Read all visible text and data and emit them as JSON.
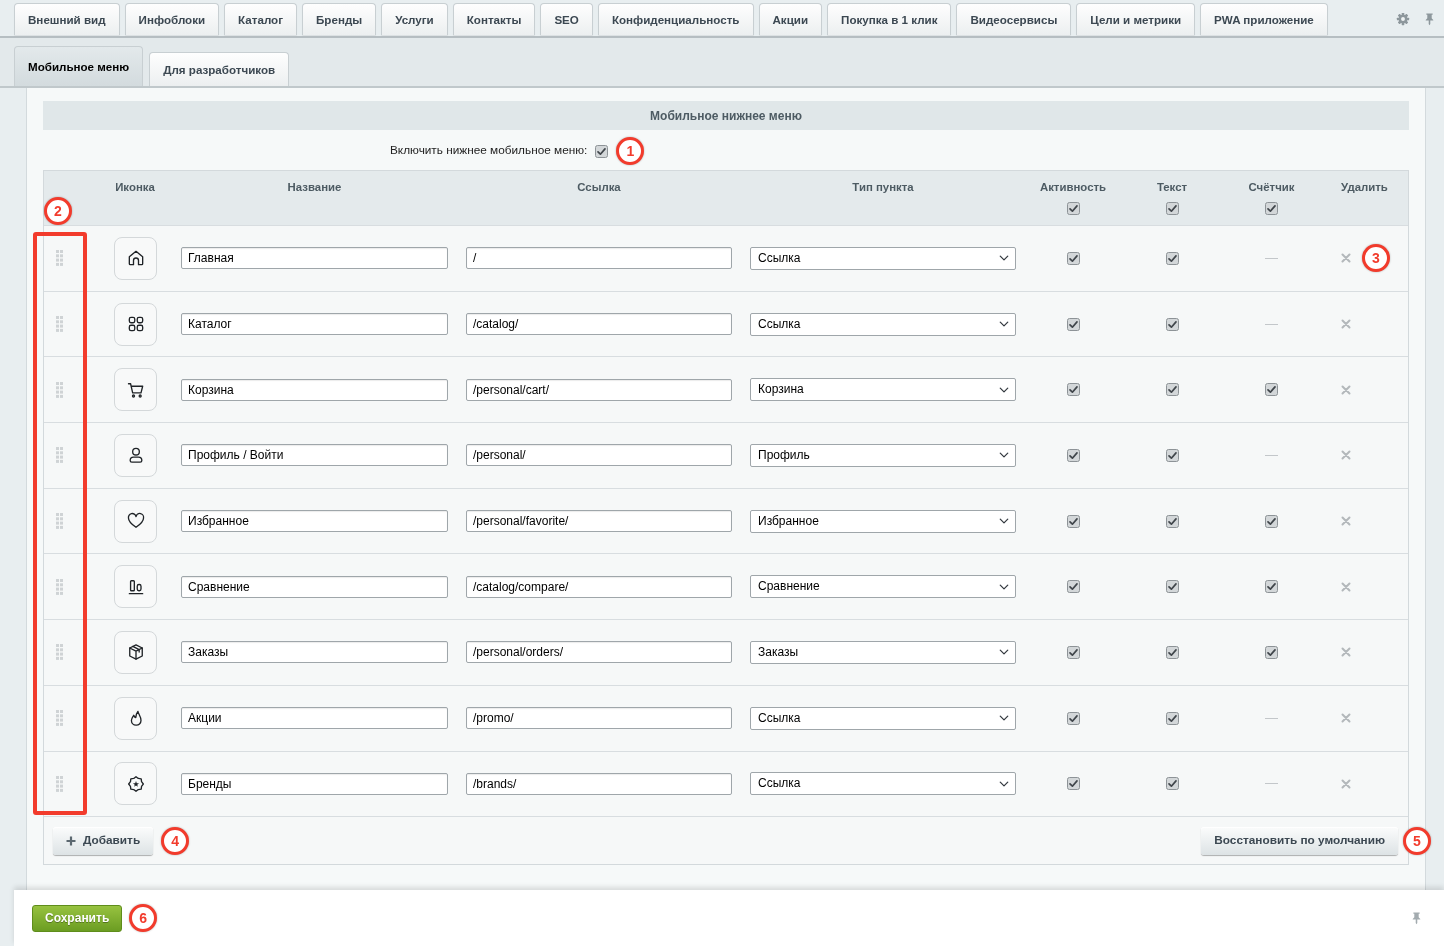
{
  "top_tabs": [
    {
      "label": "Внешний вид",
      "selected": false
    },
    {
      "label": "Инфоблоки",
      "selected": false
    },
    {
      "label": "Каталог",
      "selected": false
    },
    {
      "label": "Бренды",
      "selected": false
    },
    {
      "label": "Услуги",
      "selected": false
    },
    {
      "label": "Контакты",
      "selected": false
    },
    {
      "label": "SEO",
      "selected": false
    },
    {
      "label": "Конфиденциальность",
      "selected": false
    },
    {
      "label": "Акции",
      "selected": false
    },
    {
      "label": "Покупка в 1 клик",
      "selected": false
    },
    {
      "label": "Видеосервисы",
      "selected": false
    },
    {
      "label": "Цели и метрики",
      "selected": false
    },
    {
      "label": "PWA приложение",
      "selected": false
    }
  ],
  "sub_tabs": [
    {
      "label": "Мобильное меню",
      "selected": true
    },
    {
      "label": "Для разработчиков",
      "selected": false
    }
  ],
  "section": {
    "title": "Мобильное нижнее меню",
    "enable_label": "Включить нижнее мобильное меню:",
    "enabled": true,
    "annotation": "1"
  },
  "table": {
    "annotation": "2",
    "highlight_drag_column": true,
    "columns": [
      {
        "label": "Иконка",
        "kind": "plain"
      },
      {
        "label": "Название",
        "kind": "plain"
      },
      {
        "label": "Ссылка",
        "kind": "plain"
      },
      {
        "label": "Тип пункта",
        "kind": "plain"
      },
      {
        "label": "Активность",
        "kind": "toggle",
        "checked": true
      },
      {
        "label": "Текст",
        "kind": "toggle",
        "checked": true
      },
      {
        "label": "Счётчик",
        "kind": "toggle",
        "checked": true
      },
      {
        "label": "Удалить",
        "kind": "plain"
      }
    ],
    "rows": [
      {
        "name": "Главная",
        "link": "/",
        "type": "Ссылка",
        "active": true,
        "text": true,
        "counter": {
          "kind": "dash"
        },
        "annotation": "3"
      },
      {
        "name": "Каталог",
        "link": "/catalog/",
        "type": "Ссылка",
        "active": true,
        "text": true,
        "counter": {
          "kind": "dash"
        }
      },
      {
        "name": "Корзина",
        "link": "/personal/cart/",
        "type": "Корзина",
        "active": true,
        "text": true,
        "counter": {
          "kind": "checkbox",
          "checked": true
        }
      },
      {
        "name": "Профиль / Войти",
        "link": "/personal/",
        "type": "Профиль",
        "active": true,
        "text": true,
        "counter": {
          "kind": "dash"
        }
      },
      {
        "name": "Избранное",
        "link": "/personal/favorite/",
        "type": "Избранное",
        "active": true,
        "text": true,
        "counter": {
          "kind": "checkbox",
          "checked": true
        }
      },
      {
        "name": "Сравнение",
        "link": "/catalog/compare/",
        "type": "Сравнение",
        "active": true,
        "text": true,
        "counter": {
          "kind": "checkbox",
          "checked": true
        }
      },
      {
        "name": "Заказы",
        "link": "/personal/orders/",
        "type": "Заказы",
        "active": true,
        "text": true,
        "counter": {
          "kind": "checkbox",
          "checked": true
        }
      },
      {
        "name": "Акции",
        "link": "/promo/",
        "type": "Ссылка",
        "active": true,
        "text": true,
        "counter": {
          "kind": "dash"
        }
      },
      {
        "name": "Бренды",
        "link": "/brands/",
        "type": "Ссылка",
        "active": true,
        "text": true,
        "counter": {
          "kind": "dash"
        }
      }
    ]
  },
  "add_button": {
    "label": "Добавить",
    "annotation": "4"
  },
  "restore_button": {
    "label": "Восстановить по умолчанию",
    "annotation": "5"
  },
  "save_button": {
    "label": "Сохранить",
    "annotation": "6"
  }
}
